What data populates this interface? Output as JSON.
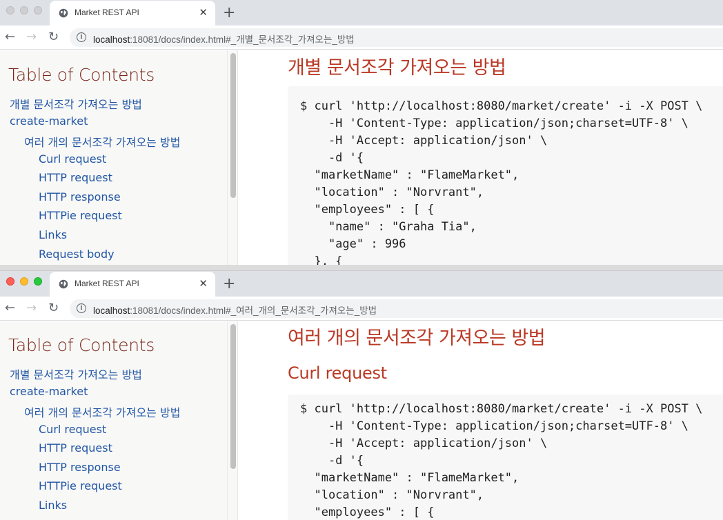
{
  "windows": [
    {
      "tab_title": "Market REST API",
      "url_host": "localhost",
      "url_path": ":18081/docs/index.html#_개별_문서조각_가져오는_방법",
      "toc_title": "Table of Contents",
      "toc_items": [
        {
          "label": "개별 문서조각 가져오는 방법",
          "level": 1
        },
        {
          "label": "create-market",
          "level": 1
        },
        {
          "label": "여러 개의 문서조각 가져오는 방법",
          "level": 2
        },
        {
          "label": "Curl request",
          "level": 3
        },
        {
          "label": "HTTP request",
          "level": 3
        },
        {
          "label": "HTTP response",
          "level": 3
        },
        {
          "label": "HTTPie request",
          "level": 3
        },
        {
          "label": "Links",
          "level": 3
        },
        {
          "label": "Request body",
          "level": 3
        }
      ],
      "heading": "개별 문서조각 가져오는 방법",
      "subheading": "",
      "code": "$ curl 'http://localhost:8080/market/create' -i -X POST \\\n    -H 'Content-Type: application/json;charset=UTF-8' \\\n    -H 'Accept: application/json' \\\n    -d '{\n  \"marketName\" : \"FlameMarket\",\n  \"location\" : \"Norvrant\",\n  \"employees\" : [ {\n    \"name\" : \"Graha Tia\",\n    \"age\" : 996\n  }, {"
    },
    {
      "tab_title": "Market REST API",
      "url_host": "localhost",
      "url_path": ":18081/docs/index.html#_여러_개의_문서조각_가져오는_방법",
      "toc_title": "Table of Contents",
      "toc_items": [
        {
          "label": "개별 문서조각 가져오는 방법",
          "level": 1
        },
        {
          "label": "create-market",
          "level": 1
        },
        {
          "label": "여러 개의 문서조각 가져오는 방법",
          "level": 2
        },
        {
          "label": "Curl request",
          "level": 3
        },
        {
          "label": "HTTP request",
          "level": 3
        },
        {
          "label": "HTTP response",
          "level": 3
        },
        {
          "label": "HTTPie request",
          "level": 3
        },
        {
          "label": "Links",
          "level": 3
        }
      ],
      "heading": "여러 개의 문서조각 가져오는 방법",
      "subheading": "Curl request",
      "code": "$ curl 'http://localhost:8080/market/create' -i -X POST \\\n    -H 'Content-Type: application/json;charset=UTF-8' \\\n    -H 'Accept: application/json' \\\n    -d '{\n  \"marketName\" : \"FlameMarket\",\n  \"location\" : \"Norvrant\",\n  \"employees\" : [ {"
    }
  ],
  "icons": {
    "globe": "globe-icon",
    "close": "close-icon",
    "new_tab": "plus-icon",
    "back": "arrow-left-icon",
    "forward": "arrow-right-icon",
    "reload": "reload-icon",
    "site_info": "info-icon"
  },
  "glyphs": {
    "close": "✕",
    "new_tab": "+",
    "back": "←",
    "forward": "→",
    "reload": "↻",
    "info": "i"
  },
  "colors": {
    "heading": "#ba3925",
    "toc_title": "#7a2518",
    "link": "#2156a5",
    "code_bg": "#f7f7f8",
    "tabbar_bg": "#dee1e6"
  }
}
